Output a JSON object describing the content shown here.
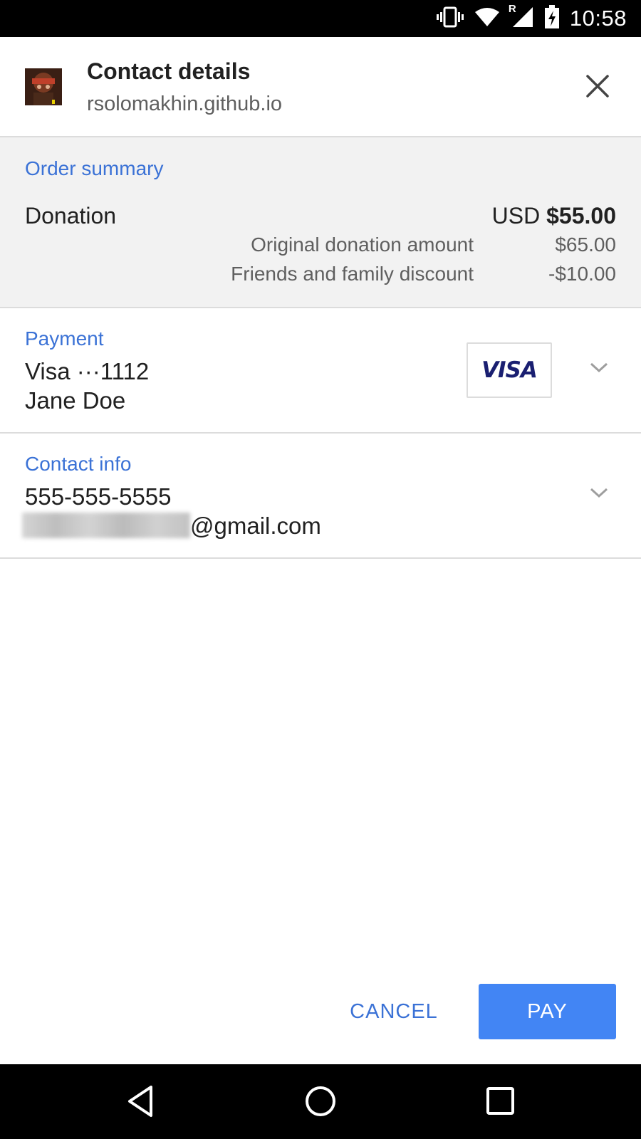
{
  "status_bar": {
    "time": "10:58",
    "icons": [
      "vibrate-icon",
      "wifi-icon",
      "signal-roaming-icon",
      "battery-charging-icon"
    ],
    "roaming_indicator": "R"
  },
  "header": {
    "title": "Contact details",
    "subtitle": "rsolomakhin.github.io",
    "close_icon": "close-icon"
  },
  "order_summary": {
    "heading": "Order summary",
    "label": "Donation",
    "currency": "USD",
    "total": "$55.00",
    "items": [
      {
        "label": "Original donation amount",
        "amount": "$65.00"
      },
      {
        "label": "Friends and family discount",
        "amount": "-$10.00"
      }
    ]
  },
  "payment": {
    "heading": "Payment",
    "card_line": "Visa ···1112",
    "name": "Jane Doe",
    "card_brand": "VISA"
  },
  "contact_info": {
    "heading": "Contact info",
    "phone": "555-555-5555",
    "email_suffix": "@gmail.com"
  },
  "actions": {
    "cancel_label": "CANCEL",
    "pay_label": "PAY"
  },
  "colors": {
    "accent": "#3b72d6",
    "pay_button": "#4285f4",
    "section_bg": "#f2f2f2",
    "visa_blue": "#1a1f71"
  },
  "nav": {
    "icons": [
      "back-icon",
      "home-icon",
      "recents-icon"
    ]
  }
}
